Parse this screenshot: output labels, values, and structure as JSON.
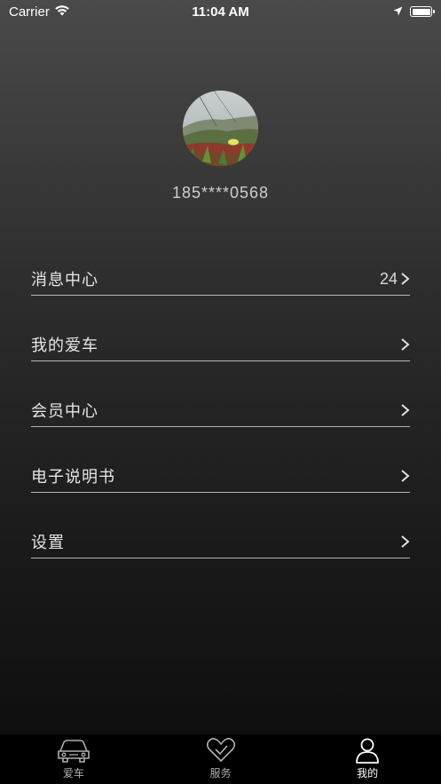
{
  "status_bar": {
    "carrier": "Carrier",
    "time": "11:04 AM"
  },
  "profile": {
    "phone": "185****0568"
  },
  "menu": {
    "items": [
      {
        "label": "消息中心",
        "badge": "24"
      },
      {
        "label": "我的爱车",
        "badge": ""
      },
      {
        "label": "会员中心",
        "badge": ""
      },
      {
        "label": "电子说明书",
        "badge": ""
      },
      {
        "label": "设置",
        "badge": ""
      }
    ]
  },
  "tabbar": {
    "tabs": [
      {
        "label": "爱车",
        "icon": "car-icon"
      },
      {
        "label": "服务",
        "icon": "heart-check-icon"
      },
      {
        "label": "我的",
        "icon": "person-icon",
        "active": true
      }
    ]
  },
  "colors": {
    "background_top": "#4a4a4a",
    "background_bottom": "#0c0c0c",
    "tabbar": "#000000",
    "divider": "#b5b5b5"
  }
}
